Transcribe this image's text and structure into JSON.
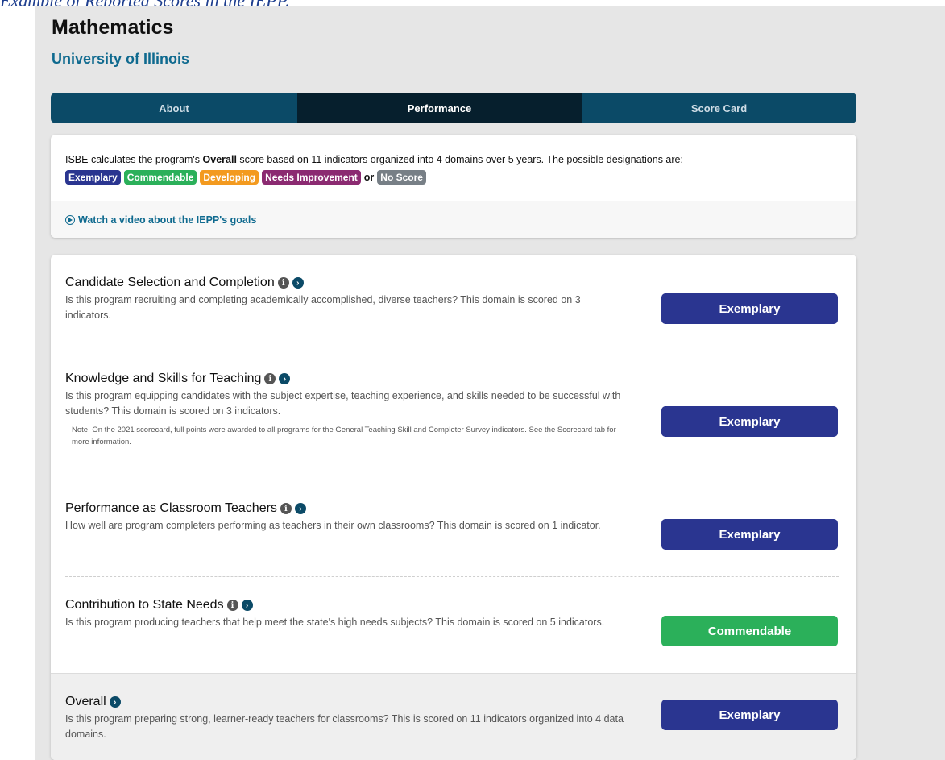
{
  "caption": "Example of Reported Scores in the IEPP.",
  "program": {
    "title": "Mathematics",
    "institution": "University of Illinois"
  },
  "tabs": [
    {
      "label": "About",
      "active": false
    },
    {
      "label": "Performance",
      "active": true
    },
    {
      "label": "Score Card",
      "active": false
    }
  ],
  "info": {
    "text_before": "ISBE calculates the program's ",
    "text_bold": "Overall",
    "text_after": " score based on 11 indicators organized into 4 domains over 5 years. The possible designations are:",
    "designations": [
      "Exemplary",
      "Commendable",
      "Developing",
      "Needs Improvement"
    ],
    "or_text": "or",
    "last_designation": "No Score",
    "video_link": "Watch a video about the IEPP's goals"
  },
  "domains": [
    {
      "title": "Candidate Selection and Completion",
      "description": "Is this program recruiting and completing academically accomplished, diverse teachers? This domain is scored on 3 indicators.",
      "note": "",
      "rating": "Exemplary"
    },
    {
      "title": "Knowledge and Skills for Teaching",
      "description": "Is this program equipping candidates with the subject expertise, teaching experience, and skills needed to be successful with students? This domain is scored on 3 indicators.",
      "note": "Note: On the 2021 scorecard, full points were awarded to all programs for the General Teaching Skill and Completer Survey indicators. See the Scorecard tab for more information.",
      "rating": "Exemplary"
    },
    {
      "title": "Performance as Classroom Teachers",
      "description": "How well are program completers performing as teachers in their own classrooms? This domain is scored on 1 indicator.",
      "note": "",
      "rating": "Exemplary"
    },
    {
      "title": "Contribution to State Needs",
      "description": "Is this program producing teachers that help meet the state's high needs subjects? This domain is scored on 5 indicators.",
      "note": "",
      "rating": "Commendable"
    }
  ],
  "overall": {
    "title": "Overall",
    "description": "Is this program preparing strong, learner-ready teachers for classrooms? This is scored on 11 indicators organized into 4 data domains.",
    "rating": "Exemplary"
  },
  "colors": {
    "exemplary": "#2a3590",
    "commendable": "#2bb05a",
    "developing": "#f39a1f",
    "needs_improvement": "#8b2a71",
    "no_score": "#777f86",
    "tab_bar": "#0b4a67",
    "tab_active": "#061f2d"
  }
}
